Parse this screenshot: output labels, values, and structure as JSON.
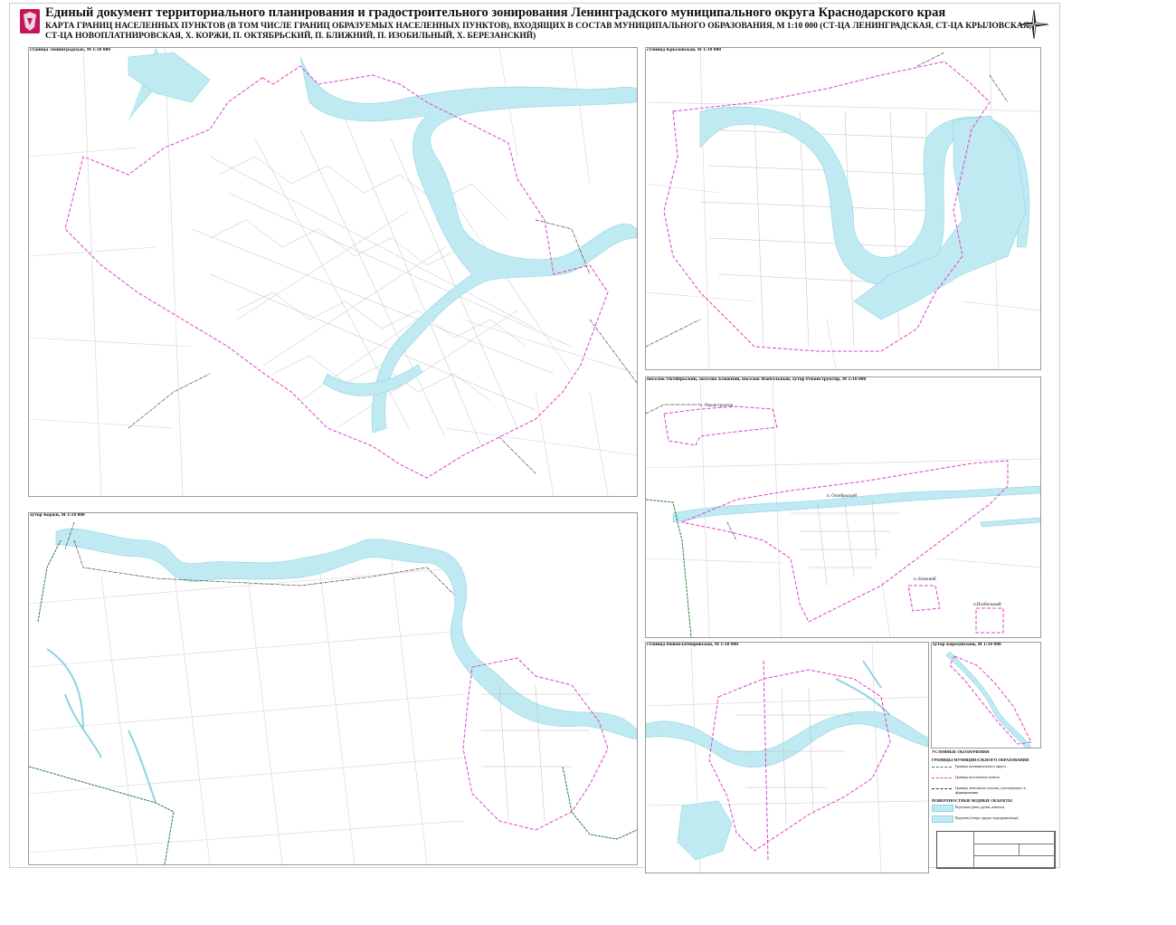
{
  "header": {
    "title": "Единый документ территориального планирования и градостроительного зонирования Ленинградского муниципального округа Краснодарского края",
    "subtitle_line1": "КАРТА ГРАНИЦ НАСЕЛЕННЫХ ПУНКТОВ (В ТОМ ЧИСЛЕ ГРАНИЦ ОБРАЗУЕМЫХ НАСЕЛЕННЫХ ПУНКТОВ), ВХОДЯЩИХ В СОСТАВ МУНИЦИПАЛЬНОГО ОБРАЗОВАНИЯ, М 1:10 000  (СТ-ЦА ЛЕНИНГРАДСКАЯ, СТ-ЦА КРЫЛОВСКАЯ,",
    "subtitle_line2": "СТ-ЦА НОВОПЛАТНИРОВСКАЯ, Х. КОРЖИ, П. ОКТЯБРЬСКИЙ, П. БЛИЖНИЙ, П. ИЗОБИЛЬНЫЙ, Х. БЕРЕЗАНСКИЙ)"
  },
  "panels": {
    "leningradskaya": "станица Ленинградская, М 1:10 000",
    "krylovskaya": "станица Крыловская, М 1:10 000",
    "korzhi": "хутор Коржи, М 1:10 000",
    "oktyabrsky": "поселок Октябрьский, поселок Ближний, поселок Изобильный, хутор Реконструктор, М 1:10 000",
    "novoplatnirovskaya": "станица Новоплатнировская, М 1:10 000",
    "berezansky": "хутор Березанский, М 1:10 000"
  },
  "places": {
    "rekonstruktor": "х. Реконструктор",
    "oktyabrsky": "п. Октябрьский",
    "blizhny": "п. Ближний",
    "izobilny": "п.Изобильный"
  },
  "legend": {
    "title": "УСЛОВНЫЕ ОБОЗНАЧЕНИЯ",
    "section1": "ГРАНИЦЫ МУНИЦИПАЛЬНОГО ОБРАЗОВАНИЯ",
    "row1": "Граница муниципального округа",
    "row2": "Граница населенного пункта",
    "row3": "Граница земельного участка, участвующего в формировании",
    "section2": "ПОВЕРХНОСТНЫЕ ВОДНЫЕ ОБЪЕКТЫ",
    "row4": "Водотоки (реки, ручьи, каналы)",
    "row5": "Водоемы (озера, пруды, водохранилища)"
  },
  "colors": {
    "water": "#bfeaf2",
    "water_stroke": "#8fd3e3",
    "boundary_pink": "#e040c8",
    "boundary_black": "#333333",
    "boundary_green": "#2e7d32",
    "roads": "#c8c8c8",
    "brand": "#c2185b"
  },
  "icons": {
    "emblem": "coat-of-arms-icon",
    "compass": "north-arrow-icon"
  }
}
